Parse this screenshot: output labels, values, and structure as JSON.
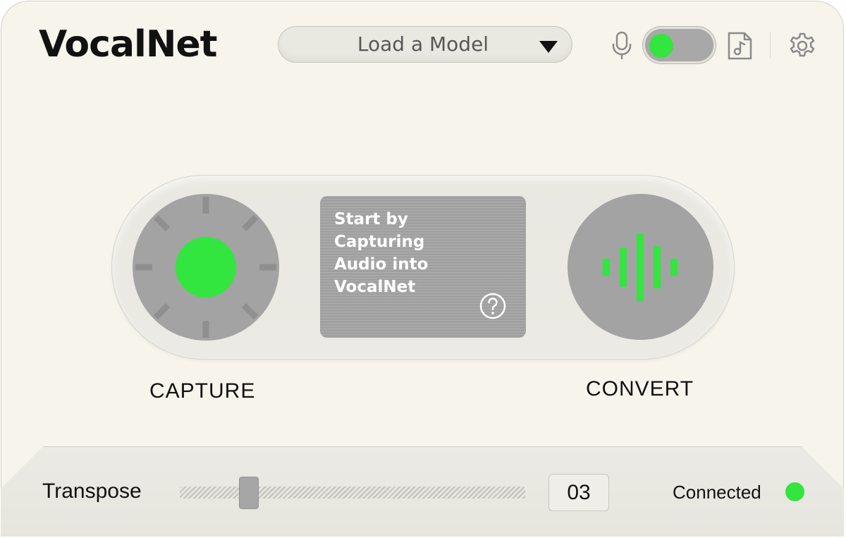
{
  "app": {
    "title": "VocalNet"
  },
  "header": {
    "model_select": {
      "label": "Load a Model"
    },
    "icons": {
      "mic": "microphone-icon",
      "music": "music-file-icon",
      "settings": "gear-icon"
    },
    "input_toggle": {
      "on": true
    }
  },
  "controls": {
    "capture_label": "CAPTURE",
    "convert_label": "CONVERT",
    "display_message": "Start by Capturing Audio into VocalNet",
    "help_icon": "question-mark-icon"
  },
  "footer": {
    "transpose_label": "Transpose",
    "transpose_value": "03",
    "transpose_slider_fraction": 0.2,
    "status_text": "Connected"
  },
  "colors": {
    "accent_green": "#33e53f",
    "control_gray": "#a3a3a3",
    "background": "#f7f4ec",
    "text": "#111111"
  }
}
